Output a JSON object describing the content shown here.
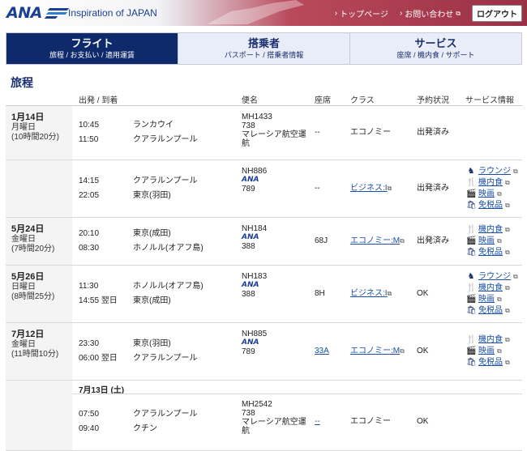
{
  "brand": {
    "logo": "ANA",
    "tagline": "Inspiration of JAPAN"
  },
  "topnav": {
    "home": "トップページ",
    "contact": "お問い合わせ",
    "logout": "ログアウト"
  },
  "tabs": [
    {
      "title": "フライト",
      "sub": "旅程 / お支払い / 適用運賃",
      "active": true
    },
    {
      "title": "搭乗者",
      "sub": "パスポート / 搭乗者情報",
      "active": false
    },
    {
      "title": "サービス",
      "sub": "座席 / 機内食 / サポート",
      "active": false
    }
  ],
  "section_title": "旅程",
  "columns": {
    "route": "出発 / 到着",
    "flight": "便名",
    "seat": "座席",
    "class": "クラス",
    "status": "予約状況",
    "service": "サービス情報"
  },
  "trips": [
    {
      "date": "1月14日",
      "weekday": "月曜日",
      "duration": "(10時間20分)",
      "segments": [
        {
          "dep_time": "10:45",
          "arr_time": "11:50",
          "dep": "ランカウイ",
          "arr": "クアラルンプール",
          "flight": "MH1433",
          "ana_logo": "",
          "aircraft": "738",
          "carrier": "マレーシア航空運航",
          "seat": "--",
          "cls": "エコノミー",
          "cls_link": false,
          "status": "出発済み",
          "services": []
        },
        {
          "dep_time": "14:15",
          "arr_time": "22:05",
          "dep": "クアラルンプール",
          "arr": "東京(羽田)",
          "flight": "NH886",
          "ana_logo": "ANA",
          "aircraft": "789",
          "carrier": "",
          "seat": "--",
          "cls": "ビジネス:I",
          "cls_link": true,
          "status": "出発済み",
          "services": [
            {
              "icon": "lounge-icon",
              "glyph": "♞",
              "label": "ラウンジ"
            },
            {
              "icon": "meal-icon",
              "glyph": "🍴",
              "label": "機内食"
            },
            {
              "icon": "movie-icon",
              "glyph": "🎬",
              "label": "映画"
            },
            {
              "icon": "dutyfree-icon",
              "glyph": "🛍",
              "label": "免税品"
            }
          ]
        }
      ]
    },
    {
      "date": "5月24日",
      "weekday": "金曜日",
      "duration": "(7時間20分)",
      "segments": [
        {
          "dep_time": "20:10",
          "arr_time": "08:30",
          "dep": "東京(成田)",
          "arr": "ホノルル(オアフ島)",
          "flight": "NH184",
          "ana_logo": "ANA",
          "aircraft": "388",
          "carrier": "",
          "seat": "68J",
          "cls": "エコノミー:M",
          "cls_link": true,
          "status": "出発済み",
          "services": [
            {
              "icon": "meal-icon",
              "glyph": "🍴",
              "label": "機内食"
            },
            {
              "icon": "movie-icon",
              "glyph": "🎬",
              "label": "映画"
            },
            {
              "icon": "dutyfree-icon",
              "glyph": "🛍",
              "label": "免税品"
            }
          ]
        }
      ]
    },
    {
      "date": "5月26日",
      "weekday": "日曜日",
      "duration": "(8時間25分)",
      "segments": [
        {
          "dep_time": "11:30",
          "arr_time": "14:55 翌日",
          "dep": "ホノルル(オアフ島)",
          "arr": "東京(成田)",
          "flight": "NH183",
          "ana_logo": "ANA",
          "aircraft": "388",
          "carrier": "",
          "seat": "8H",
          "cls": "ビジネス:I",
          "cls_link": true,
          "status": "OK",
          "services": [
            {
              "icon": "lounge-icon",
              "glyph": "♞",
              "label": "ラウンジ"
            },
            {
              "icon": "meal-icon",
              "glyph": "🍴",
              "label": "機内食"
            },
            {
              "icon": "movie-icon",
              "glyph": "🎬",
              "label": "映画"
            },
            {
              "icon": "dutyfree-icon",
              "glyph": "🛍",
              "label": "免税品"
            }
          ]
        }
      ]
    },
    {
      "date": "7月12日",
      "weekday": "金曜日",
      "duration": "(11時間10分)",
      "segments": [
        {
          "dep_time": "23:30",
          "arr_time": "06:00 翌日",
          "dep": "東京(羽田)",
          "arr": "クアラルンプール",
          "flight": "NH885",
          "ana_logo": "ANA",
          "aircraft": "789",
          "carrier": "",
          "seat": "33A",
          "seat_link": true,
          "cls": "エコノミー:M",
          "cls_link": true,
          "status": "OK",
          "services": [
            {
              "icon": "meal-icon",
              "glyph": "🍴",
              "label": "機内食"
            },
            {
              "icon": "movie-icon",
              "glyph": "🎬",
              "label": "映画"
            },
            {
              "icon": "dutyfree-icon",
              "glyph": "🛍",
              "label": "免税品"
            }
          ]
        },
        {
          "subdate": "7月13日 (土)",
          "dep_time": "07:50",
          "arr_time": "09:40",
          "dep": "クアラルンプール",
          "arr": "クチン",
          "flight": "MH2542",
          "ana_logo": "",
          "aircraft": "738",
          "carrier": "マレーシア航空運航",
          "seat": "--",
          "seat_link": true,
          "cls": "エコノミー",
          "cls_link": false,
          "status": "OK",
          "services": []
        }
      ]
    }
  ]
}
